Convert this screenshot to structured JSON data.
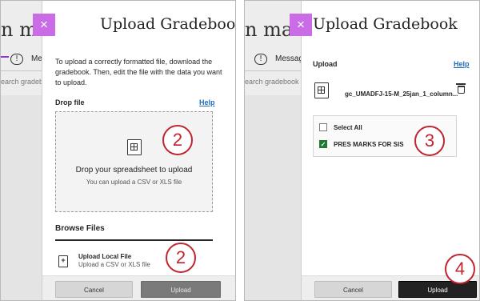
{
  "background": {
    "title_fragment": "n makin",
    "tab_badge": "!",
    "tab_label": "Message",
    "search_fragment": "earch gradebook",
    "sort_arrow": "◆"
  },
  "modal": {
    "close_symbol": "×",
    "title": "Upload Gradebook"
  },
  "left": {
    "intro_text": "To upload a correctly formatted file, download the gradebook. Then, edit the file with the data you want to upload.",
    "drop_file_label": "Drop file",
    "help_label": "Help",
    "drop_main": "Drop your spreadsheet to upload",
    "drop_sub": "You can upload a CSV or XLS file",
    "browse_heading": "Browse Files",
    "upload_local_icon": "+",
    "upload_local_label": "Upload Local File",
    "upload_local_sub": "Upload a CSV or XLS file",
    "cancel_label": "Cancel",
    "upload_label": "Upload",
    "badge_drop": "2",
    "badge_browse": "2"
  },
  "right": {
    "upload_label_heading": "Upload",
    "help_label": "Help",
    "file_name": "gc_UMADFJ-15-M_25jan_1_column...",
    "select_all_label": "Select All",
    "column_label": "PRES MARKS FOR SIS",
    "checkmark": "✓",
    "cancel_label": "Cancel",
    "upload_label": "Upload",
    "badge_select": "3",
    "badge_upload": "4"
  },
  "colors": {
    "accent": "#c96ce6",
    "badge": "#c0252d",
    "link": "#1f6ebf",
    "check": "#1e7a2f"
  }
}
